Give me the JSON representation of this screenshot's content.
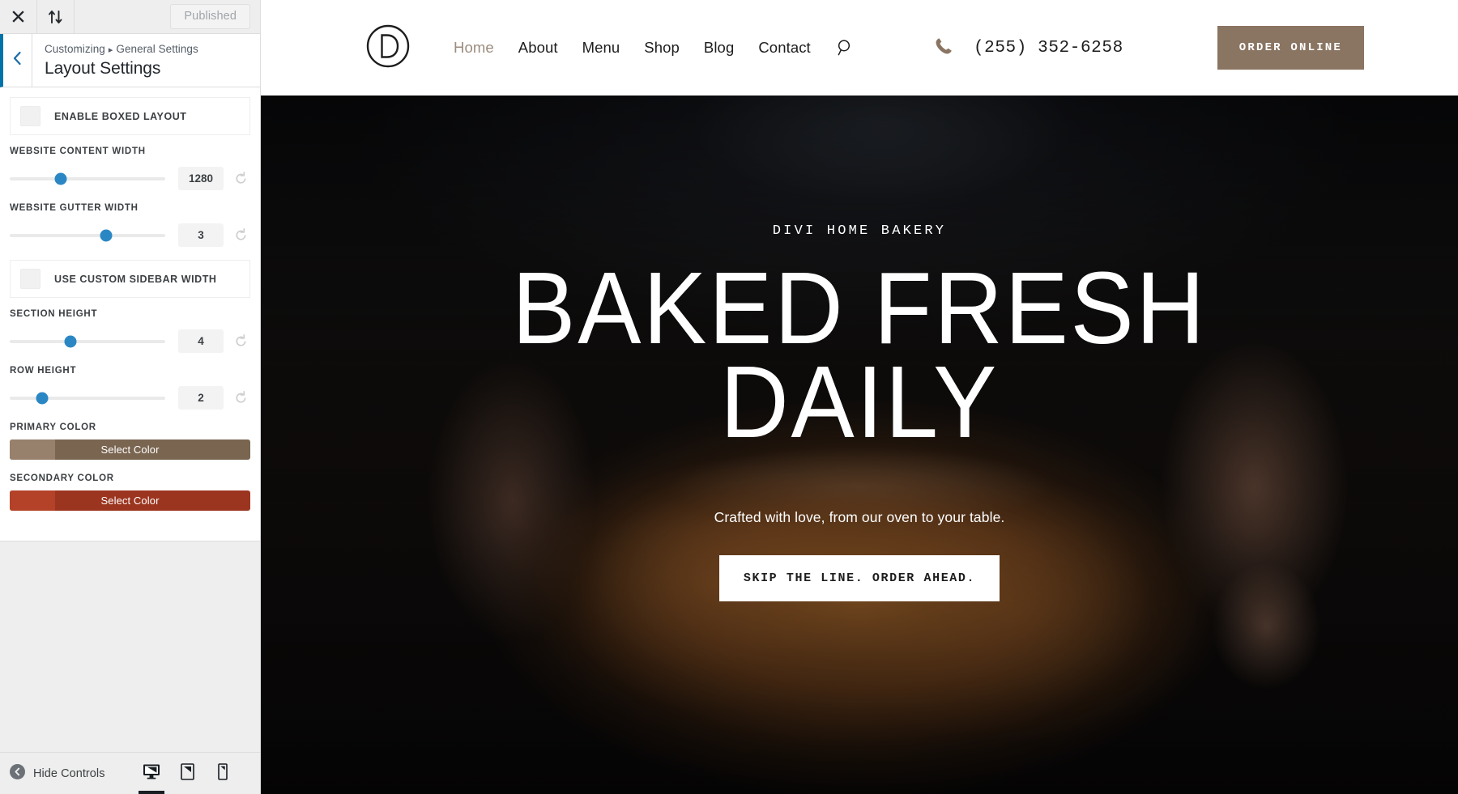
{
  "customizer": {
    "topbar": {
      "close_icon": "close-icon",
      "collapse_icon": "sort-updown-icon",
      "publish_label": "Published"
    },
    "header": {
      "back_icon": "chevron-left-icon",
      "breadcrumb_root": "Customizing",
      "breadcrumb_separator": "▸",
      "breadcrumb_parent": "General Settings",
      "panel_title": "Layout Settings",
      "accent_color": "#0073aa"
    },
    "controls": [
      {
        "type": "checkbox",
        "name": "enable-boxed-layout",
        "label": "ENABLE BOXED LAYOUT",
        "checked": false
      },
      {
        "type": "slider",
        "name": "website-content-width",
        "label": "WEBSITE CONTENT WIDTH",
        "value": "1280",
        "percent": 33,
        "reset_icon": "reset-icon"
      },
      {
        "type": "slider",
        "name": "website-gutter-width",
        "label": "WEBSITE GUTTER WIDTH",
        "value": "3",
        "percent": 62,
        "reset_icon": "reset-icon"
      },
      {
        "type": "checkbox",
        "name": "use-custom-sidebar-width",
        "label": "USE CUSTOM SIDEBAR WIDTH",
        "checked": false
      },
      {
        "type": "slider",
        "name": "section-height",
        "label": "SECTION HEIGHT",
        "value": "4",
        "percent": 39,
        "reset_icon": "reset-icon"
      },
      {
        "type": "slider",
        "name": "row-height",
        "label": "ROW HEIGHT",
        "value": "2",
        "percent": 21,
        "reset_icon": "reset-icon"
      },
      {
        "type": "color",
        "name": "primary-color",
        "label": "PRIMARY COLOR",
        "button_label": "Select Color",
        "color": "#7a6551",
        "swatch": "#97806c"
      },
      {
        "type": "color",
        "name": "secondary-color",
        "label": "SECONDARY COLOR",
        "button_label": "Select Color",
        "color": "#9c3520",
        "swatch": "#b34228"
      }
    ],
    "footer": {
      "hide_controls_label": "Hide Controls",
      "hide_controls_icon": "chevron-left-circle-icon",
      "devices": [
        {
          "name": "desktop",
          "icon": "desktop-icon",
          "active": true
        },
        {
          "name": "tablet",
          "icon": "tablet-icon",
          "active": false
        },
        {
          "name": "mobile",
          "icon": "mobile-icon",
          "active": false
        }
      ]
    }
  },
  "site": {
    "header": {
      "logo_letter": "D",
      "logo_icon": "divi-circle-logo",
      "nav": [
        {
          "label": "Home",
          "active": true
        },
        {
          "label": "About",
          "active": false
        },
        {
          "label": "Menu",
          "active": false
        },
        {
          "label": "Shop",
          "active": false
        },
        {
          "label": "Blog",
          "active": false
        },
        {
          "label": "Contact",
          "active": false
        }
      ],
      "search_icon": "search-icon",
      "phone_icon": "phone-icon",
      "phone_number": "(255) 352-6258",
      "order_button_label": "ORDER ONLINE",
      "order_button_color": "#8a7462",
      "active_nav_color": "#9b8c7e"
    },
    "hero": {
      "eyebrow": "DIVI HOME BAKERY",
      "title": "BAKED FRESH\nDAILY",
      "subtitle": "Crafted with love, from our oven to your table.",
      "cta_label": "SKIP THE LINE. ORDER AHEAD."
    }
  }
}
